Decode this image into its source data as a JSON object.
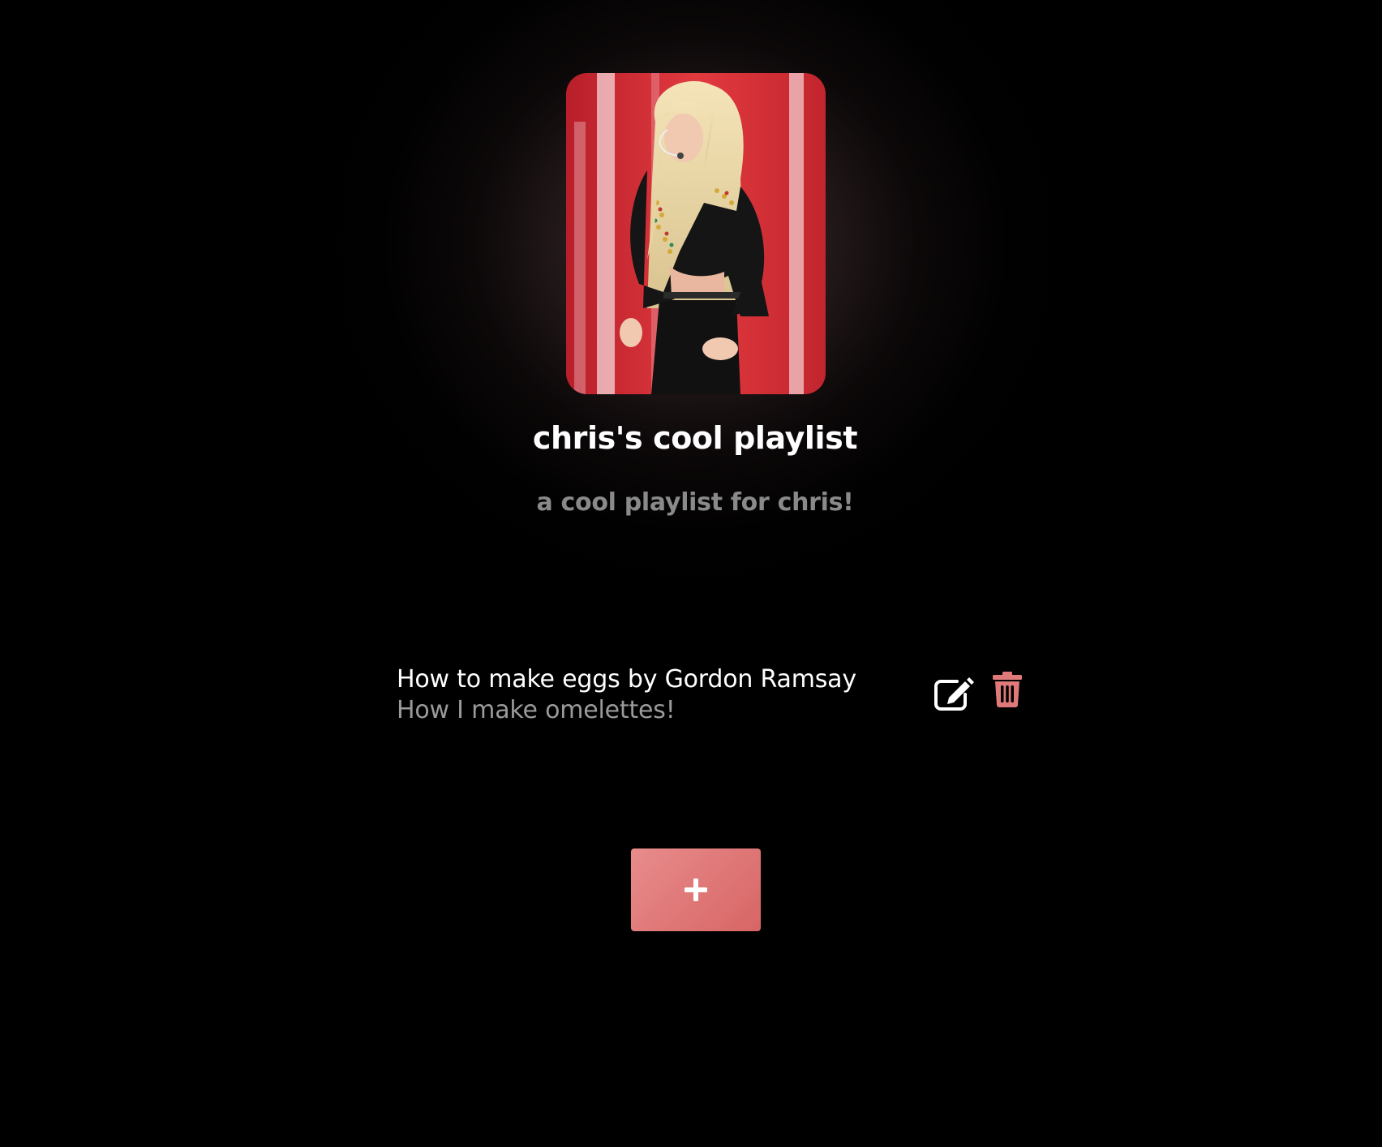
{
  "playlist": {
    "title": "chris's cool playlist",
    "description": "a cool playlist for chris!",
    "cover_image": "performer-photo"
  },
  "songs": [
    {
      "title": "How to make eggs by Gordon Ramsay",
      "description": "How I make omelettes!",
      "edit_icon": "edit-icon",
      "delete_icon": "trash-icon"
    }
  ],
  "add_button": {
    "icon": "plus-icon"
  },
  "colors": {
    "background": "#000000",
    "accent": "#e07a7a",
    "title_text": "#ffffff",
    "muted_text": "#8a8a8a"
  }
}
